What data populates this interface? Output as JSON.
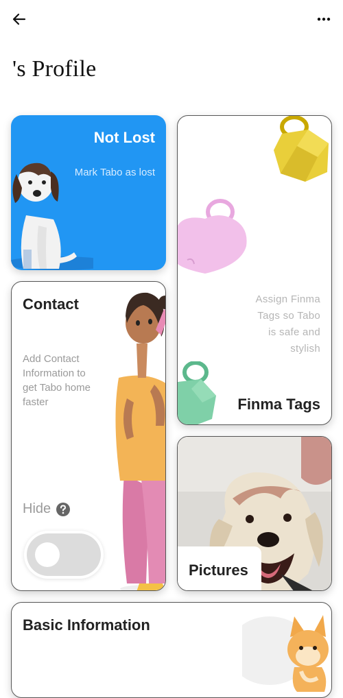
{
  "page": {
    "title": "'s Profile"
  },
  "icons": {
    "back": "arrow-left-icon",
    "more": "more-horizontal-icon",
    "help": "question-circle-icon"
  },
  "cards": {
    "lost": {
      "title": "Not Lost",
      "subtitle": "Mark Tabo as lost",
      "color": "#2196F3"
    },
    "contact": {
      "title": "Contact",
      "description": "Add Contact Information to get Tabo home faster",
      "hide_label": "Hide",
      "toggle_on": false
    },
    "tags": {
      "title": "Finma Tags",
      "description": "Assign Finma Tags so Tabo is safe and stylish"
    },
    "pictures": {
      "title": "Pictures"
    },
    "basic": {
      "title": "Basic Information"
    }
  }
}
